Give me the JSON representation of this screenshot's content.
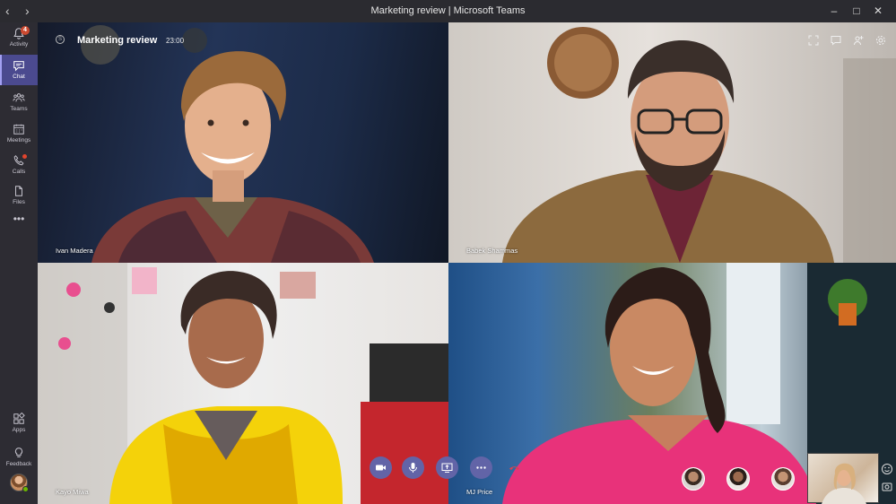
{
  "window": {
    "title": "Marketing review | Microsoft Teams"
  },
  "rail": {
    "items": [
      {
        "label": "Activity",
        "badge": "4",
        "icon": "bell-icon"
      },
      {
        "label": "Chat",
        "icon": "chat-icon",
        "active": true
      },
      {
        "label": "Teams",
        "icon": "teams-icon"
      },
      {
        "label": "Meetings",
        "icon": "calendar-icon"
      },
      {
        "label": "Calls",
        "icon": "phone-icon",
        "dot": true
      },
      {
        "label": "Files",
        "icon": "file-icon"
      },
      {
        "label": "Apps",
        "icon": "apps-icon"
      },
      {
        "label": "Feedback",
        "icon": "bulb-icon"
      }
    ]
  },
  "meeting": {
    "title": "Marketing review",
    "time": "23:00"
  },
  "participants": [
    {
      "name": "Ivan Madera"
    },
    {
      "name": "Babek Shammas"
    },
    {
      "name": "Kayo Miwa"
    },
    {
      "name": "MJ Price"
    }
  ],
  "colors": {
    "accent": "#6264a7",
    "hangup": "#c4314b",
    "rail": "#2d2c33",
    "badge": "#cc4a31"
  }
}
